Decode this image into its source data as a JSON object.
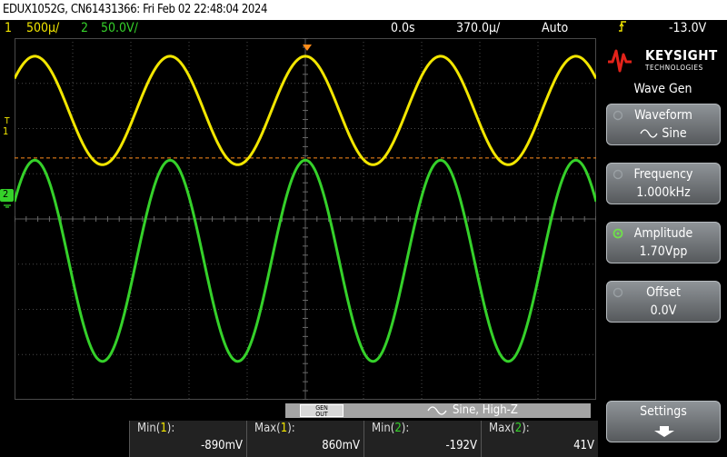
{
  "titlebar": {
    "text": "EDUX1052G, CN61431366: Fri Feb 02 22:48:04 2024"
  },
  "status": {
    "ch1_num": "1",
    "ch1_scale": "500µ/",
    "ch2_num": "2",
    "ch2_scale": "50.0V/",
    "time_offset": "0.0s",
    "time_scale": "370.0µ/",
    "trigger_mode": "Auto",
    "trigger_level": "-13.0V"
  },
  "grid": {
    "ch1_marker": "1",
    "ch2_marker": "2",
    "trig_marker": "T"
  },
  "panel": {
    "brand": "KEYSIGHT",
    "brand_sub": "TECHNOLOGIES",
    "title": "Wave Gen",
    "softkeys": [
      {
        "label": "Waveform",
        "value": "Sine"
      },
      {
        "label": "Frequency",
        "value": "1.000kHz"
      },
      {
        "label": "Amplitude",
        "value": "1.70Vpp"
      },
      {
        "label": "Offset",
        "value": "0.0V"
      }
    ],
    "settings": "Settings"
  },
  "bottom": {
    "gen_out_1": "GEN",
    "gen_out_2": "OUT",
    "signal": "Sine, High-Z"
  },
  "measurements": [
    {
      "label_pre": "Min(",
      "ch": "1",
      "label_post": "):",
      "value": "-890mV"
    },
    {
      "label_pre": "Max(",
      "ch": "1",
      "label_post": "):",
      "value": "860mV"
    },
    {
      "label_pre": "Min(",
      "ch": "2",
      "label_post": "):",
      "value": "-192V"
    },
    {
      "label_pre": "Max(",
      "ch": "2",
      "label_post": "):",
      "value": "41V"
    }
  ],
  "colors": {
    "ch1": "#f2e600",
    "ch2": "#35d12a",
    "trigger": "#ff8c1a",
    "grid": "#4a4a4a"
  },
  "chart_data": {
    "type": "line",
    "x_divisions": 10,
    "y_divisions": 8,
    "series": [
      {
        "name": "1",
        "waveform": "sine",
        "cycles": 4.3,
        "high_div": 7.6,
        "low_div": 5.2,
        "color": "#f2e600"
      },
      {
        "name": "2",
        "waveform": "sine",
        "cycles": 4.3,
        "high_div": 5.3,
        "low_div": 0.85,
        "color": "#35d12a"
      }
    ],
    "trigger_level_div": 5.35
  }
}
